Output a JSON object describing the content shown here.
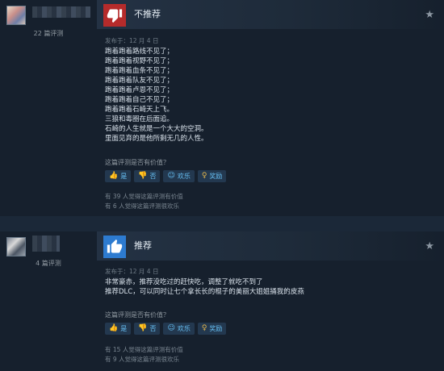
{
  "reviews": [
    {
      "reviewer": {
        "review_count": "22 篇评测"
      },
      "verdict": "不推荐",
      "verdict_icon": "thumbs-down-icon",
      "posted": "发布于：12 月 4 日",
      "lines": [
        "跑着跑着路线不见了；",
        "跑着跑着视野不见了；",
        "跑着跑着血条不见了；",
        "跑着跑着队友不见了；",
        "跑着跑着卢恩不见了；",
        "跑着跑着自己不见了；",
        "跑着跑着石崎天上飞。",
        "三狼和毒圈在后面追。",
        "石崎的人生就是一个大大的空洞。",
        "里面见弃的是他所剩无几的人性。"
      ],
      "helpful_question": "这篇评测是否有价值？",
      "buttons": {
        "yes": "是",
        "no": "否",
        "funny": "欢乐",
        "award": "奖励"
      },
      "helpful_stat": "有 39 人觉得这篇评测有价值",
      "funny_stat": "有 6 人觉得这篇评测很欢乐"
    },
    {
      "reviewer": {
        "review_count": "4 篇评测"
      },
      "verdict": "推荐",
      "verdict_icon": "thumbs-up-icon",
      "posted": "发布于：12 月 4 日",
      "lines": [
        "非常豪赤，推荐没吃过的赶快吃，调整了就吃不到了",
        "推荐DLC，可以同时让七个拿长长的棍子的美丽大姐姐捅我的皮燕"
      ],
      "helpful_question": "这篇评测是否有价值？",
      "buttons": {
        "yes": "是",
        "no": "否",
        "funny": "欢乐",
        "award": "奖励"
      },
      "helpful_stat": "有 15 人觉得这篇评测有价值",
      "funny_stat": "有 9 人觉得这篇评测很欢乐"
    }
  ],
  "colors": {
    "background": "#1b2838",
    "panel": "#16202d",
    "not_recommended": "#b52b2b",
    "recommended": "#2d7bd0",
    "link": "#67c1f5"
  }
}
